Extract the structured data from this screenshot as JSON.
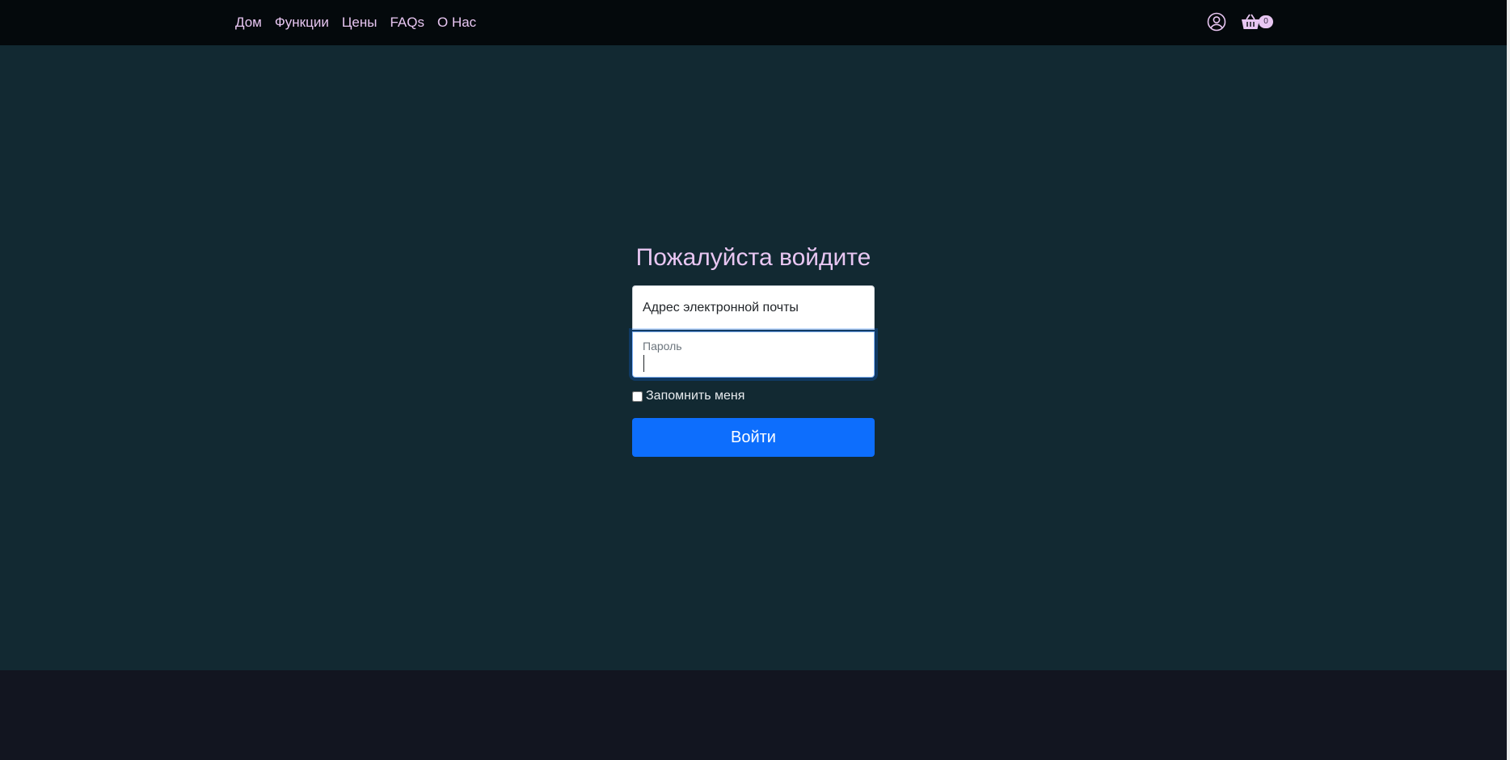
{
  "nav": {
    "links": [
      "Дом",
      "Функции",
      "Цены",
      "FAQs",
      "О Нас"
    ],
    "cart_count": "0",
    "icons": {
      "user": "user-circle-icon",
      "cart": "shopping-basket-icon"
    }
  },
  "login": {
    "title": "Пожалуйста войдите",
    "email_placeholder": "Адрес электронной почты",
    "password_label": "Пароль",
    "password_value": "",
    "remember_label": "Запомнить меня",
    "remember_checked": false,
    "submit_label": "Войти"
  },
  "colors": {
    "navbar_bg": "#04090c",
    "main_bg": "#122932",
    "footer_bg": "#121520",
    "accent_text": "#e8c6f2",
    "button_bg": "#0d6efd"
  }
}
